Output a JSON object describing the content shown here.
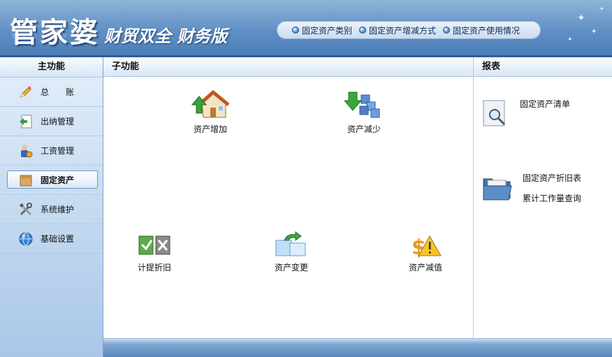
{
  "header": {
    "brand_main": "管家婆",
    "brand_sub": "财贸双全 财务版",
    "quick_links": [
      {
        "label": "固定资产类别"
      },
      {
        "label": "固定资产增减方式"
      },
      {
        "label": "固定资产使用情况"
      }
    ]
  },
  "sidebar": {
    "title": "主功能",
    "items": [
      {
        "label": "总　　账",
        "icon": "pencil-icon"
      },
      {
        "label": "出纳管理",
        "icon": "cashier-icon"
      },
      {
        "label": "工资管理",
        "icon": "salary-icon"
      },
      {
        "label": "固定资产",
        "icon": "box-icon",
        "active": true
      },
      {
        "label": "系统维护",
        "icon": "tools-icon"
      },
      {
        "label": "基础设置",
        "icon": "globe-icon"
      }
    ]
  },
  "main": {
    "title": "子功能",
    "functions": [
      {
        "label": "资产增加",
        "icon": "house-add-icon"
      },
      {
        "label": "资产减少",
        "icon": "blocks-reduce-icon"
      },
      {
        "label": "计提折旧",
        "icon": "depreciation-icon"
      },
      {
        "label": "资产变更",
        "icon": "change-icon"
      },
      {
        "label": "资产减值",
        "icon": "impairment-icon"
      }
    ]
  },
  "report": {
    "title": "报表",
    "items": [
      {
        "icon": "magnifier-doc-icon",
        "links": [
          "固定资产清单"
        ]
      },
      {
        "icon": "folder-icon",
        "links": [
          "固定资产折旧表",
          "累计工作量查询"
        ]
      }
    ]
  },
  "colors": {
    "header_blue": "#5f8fc4",
    "sidebar_blue": "#cbdff3",
    "footer_blue": "#5c88bd"
  }
}
